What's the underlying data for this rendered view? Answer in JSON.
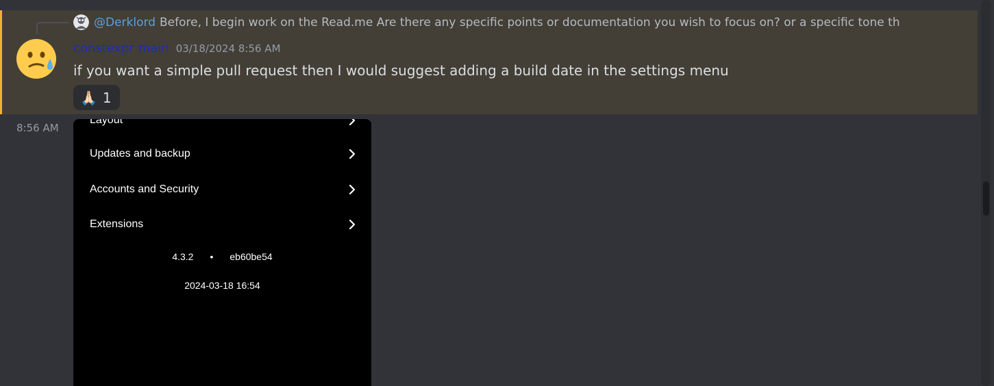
{
  "reply": {
    "author": "@Derklord",
    "text": "Before, I begin work on the Read.me Are there any specific points or documentation you wish to focus on? or a specific tone th"
  },
  "message": {
    "username": "constexpr main",
    "timestamp": "03/18/2024 8:56 AM",
    "text": "if you want a simple pull request then I would suggest adding a build date in the settings menu",
    "reaction": {
      "emoji": "🙏🏻",
      "count": "1"
    }
  },
  "followup": {
    "timestamp": "8:56 AM",
    "attachment": {
      "rows": [
        "Layout",
        "Updates and backup",
        "Accounts and Security",
        "Extensions"
      ],
      "version": "4.3.2",
      "separator": "•",
      "commit": "eb60be54",
      "build_date": "2024-03-18 16:54"
    }
  },
  "colors": {
    "highlight_bg": "#433f37",
    "highlight_border": "#f0b132",
    "username": "#1f2cb8",
    "reply_author": "#5e9fda"
  },
  "icons": {
    "avatar": "sweat-face-icon",
    "row_chevron": "chevron-right-icon"
  }
}
